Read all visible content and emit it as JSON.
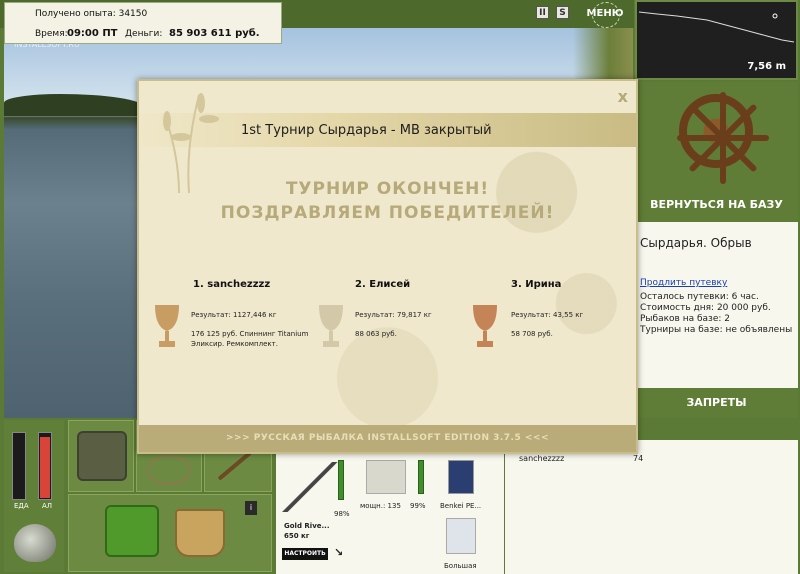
{
  "hud": {
    "exp_label": "Получено опыта: 34150",
    "time_label": "Время:",
    "time_value": "09:00 ПТ",
    "money_label": "Деньги:",
    "money_value": "85 903 611 руб.",
    "watermark": "INSTALLSOFT.RU",
    "pause_label": "II",
    "sound_label": "S",
    "menu_label": "МЕНЮ"
  },
  "depth": {
    "value": "7,56 m"
  },
  "right_panel": {
    "back_button": "ВЕРНУТЬСЯ НА БАЗУ",
    "location": "Сырдарья. Обрыв",
    "extend_link": "Продлить путевку",
    "time_left": "Осталось путевки: 6 час.",
    "day_cost": "Стоимость дня: 20 000 руб.",
    "anglers": "Рыбаков на базе: 2",
    "tournaments": "Турниры на базе: не объявлены",
    "bans_button": "ЗАПРЕТЫ"
  },
  "score": {
    "name": "sanchezzzz",
    "value": "74"
  },
  "meters": {
    "food_label": "ЕДА",
    "alcohol_label": "АЛ",
    "food_level": 0.0,
    "alcohol_level": 0.95
  },
  "gear": {
    "rod_condition": "98%",
    "rod_name": "Gold Rive...",
    "rod_weight": "650 кг",
    "setup_button": "НАСТРОИТЬ",
    "reel_power": "мощн.: 135",
    "reel_condition": "99%",
    "line_name": "Benkei PE...",
    "lure_label": "Большая",
    "info_button": "i"
  },
  "modal": {
    "title": "1st Турнир Сырдарья - МВ закрытый",
    "close": "x",
    "heading1": "ТУРНИР ОКОНЧЕН!",
    "heading2": "ПОЗДРАВЛЯЕМ ПОБЕДИТЕЛЕЙ!",
    "winners": [
      {
        "place": "1. sanchezzzz",
        "result": "Результат: 1127,446 кг",
        "prize": "176 125 руб. Спиннинг Titanium Эликсир. Ремкомплект.",
        "cup": "#c79d63"
      },
      {
        "place": "2. Елисей",
        "result": "Результат: 79,817 кг",
        "prize": "88 063 руб.",
        "cup": "#d3c9a8"
      },
      {
        "place": "3. Ирина",
        "result": "Результат: 43,55 кг",
        "prize": "58 708 руб.",
        "cup": "#c58457"
      }
    ],
    "footer": ">>> РУССКАЯ РЫБАЛКА INSTALLSOFT EDITION 3.7.5 <<<"
  }
}
